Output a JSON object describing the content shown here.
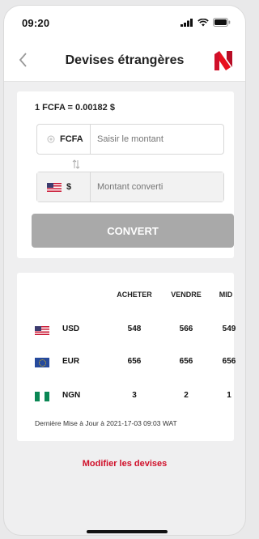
{
  "status_bar": {
    "time": "09:20",
    "icons": [
      "signal-icon",
      "wifi-icon",
      "battery-icon"
    ]
  },
  "header": {
    "title": "Devises étrangères",
    "back_icon": "chevron-left-icon",
    "logo_icon": "brand-logo-icon"
  },
  "converter": {
    "rate": "1 FCFA = 0.00182 $",
    "from_currency": "FCFA",
    "from_placeholder": "Saisir le montant",
    "to_currency": "$",
    "to_placeholder": "Montant converti",
    "button_label": "CONVERT"
  },
  "rates": {
    "columns": [
      "ACHETER",
      "VENDRE",
      "MID"
    ],
    "rows": [
      {
        "flag": "us-flag-icon",
        "code": "USD",
        "buy": "548",
        "sell": "566",
        "mid": "549"
      },
      {
        "flag": "eu-flag-icon",
        "code": "EUR",
        "buy": "656",
        "sell": "656",
        "mid": "656"
      },
      {
        "flag": "ng-flag-icon",
        "code": "NGN",
        "buy": "3",
        "sell": "2",
        "mid": "1"
      }
    ],
    "last_update": "Dernière Mise à Jour à 2021-17-03 09:03 WAT"
  },
  "footer": {
    "modify_label": "Modifier les devises"
  },
  "colors": {
    "accent": "#d0102a",
    "button_disabled": "#a9a9a9"
  }
}
